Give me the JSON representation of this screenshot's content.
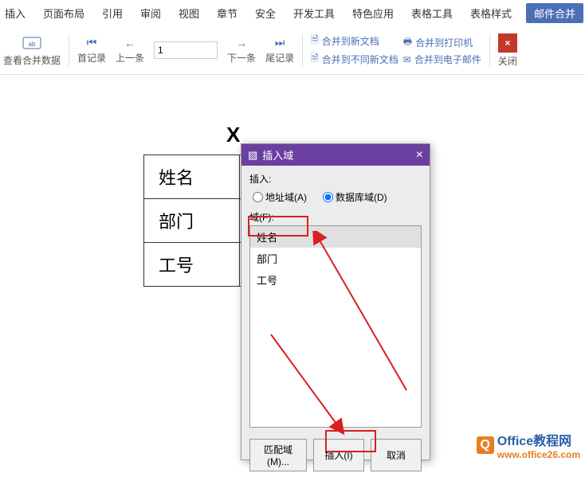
{
  "ribbon": {
    "tabs": [
      "插入",
      "页面布局",
      "引用",
      "审阅",
      "视图",
      "章节",
      "安全",
      "开发工具",
      "特色应用",
      "表格工具",
      "表格样式",
      "邮件合并"
    ],
    "active": 11
  },
  "toolbar": {
    "view_data": "查看合并数据",
    "first": "首记录",
    "prev": "上一条",
    "page_value": "1",
    "next": "下一条",
    "last": "尾记录",
    "merge_new": "合并到新文档",
    "merge_diff": "合并到不同新文档",
    "merge_print": "合并到打印机",
    "merge_email": "合并到电子邮件",
    "close": "关闭",
    "close_x": "×"
  },
  "doc": {
    "x_mark": "X",
    "rows": [
      "姓名",
      "部门",
      "工号"
    ]
  },
  "dialog": {
    "title": "插入域",
    "insert_label": "插入:",
    "radio_address": "地址域(A)",
    "radio_db": "数据库域(D)",
    "field_label": "域(F):",
    "fields": [
      "姓名",
      "部门",
      "工号"
    ],
    "selected": 0,
    "btn_match": "匹配域(M)...",
    "btn_insert": "插入(I)",
    "btn_cancel": "取消",
    "close_x": "×"
  },
  "watermark": {
    "text": "Office教程网",
    "url": "www.office26.com",
    "icon": "Q"
  }
}
